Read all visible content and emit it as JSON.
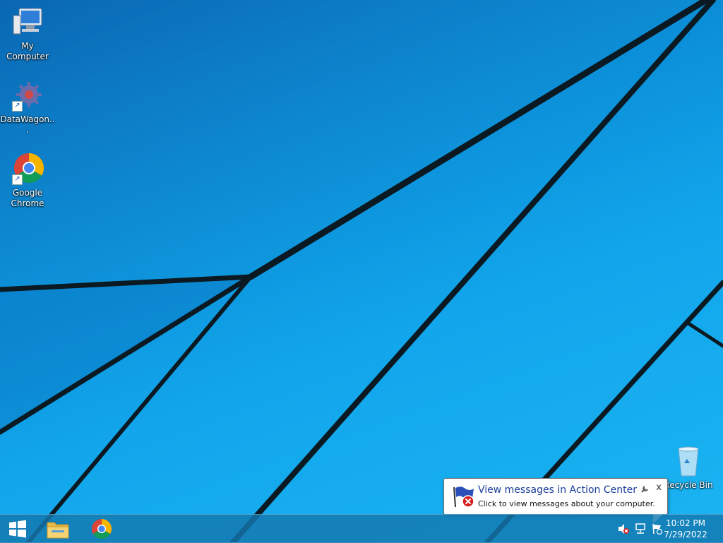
{
  "desktop": {
    "icons": [
      {
        "label": "My Computer",
        "icon": "computer-icon"
      },
      {
        "label": "DataWagon...",
        "icon": "gear-icon"
      },
      {
        "label": "Google Chrome",
        "icon": "chrome-icon"
      },
      {
        "label": "Recycle Bin",
        "icon": "recycle-bin-icon"
      }
    ]
  },
  "taskbar": {
    "start_icon": "windows-logo-icon",
    "pinned": [
      {
        "name": "File Explorer",
        "icon": "folder-icon"
      },
      {
        "name": "Google Chrome",
        "icon": "chrome-icon"
      }
    ],
    "tray_icons": [
      "speaker-muted-icon",
      "network-icon",
      "action-center-flag-icon"
    ],
    "clock": {
      "time": "10:02 PM",
      "date": "7/29/2022"
    }
  },
  "notification": {
    "title": "View messages in Action Center",
    "body": "Click to view messages about your computer.",
    "close_label": "x",
    "icon": "action-center-flag-icon"
  },
  "colors": {
    "wallpaper": "#0b8fd8",
    "taskbar": "#1478af",
    "balloon_title": "#1a3e9a"
  }
}
